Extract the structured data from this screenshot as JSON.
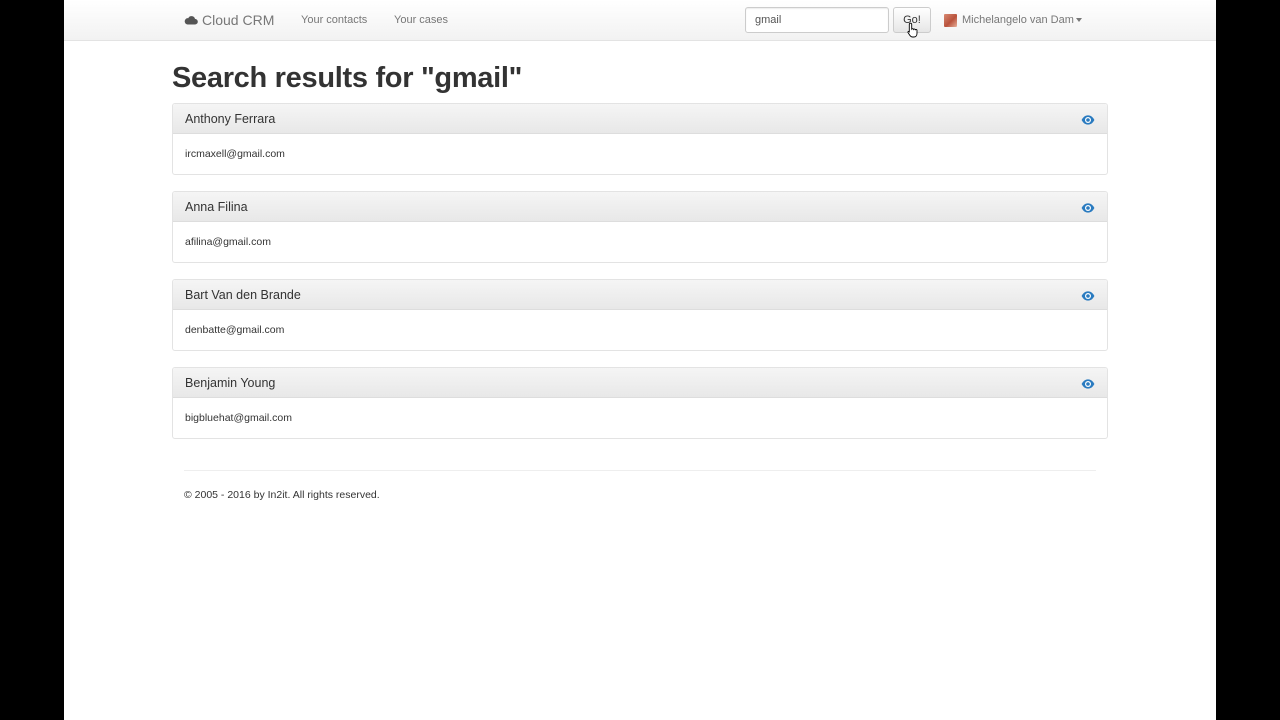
{
  "navbar": {
    "brand": "Cloud CRM",
    "links": [
      {
        "label": "Your contacts"
      },
      {
        "label": "Your cases"
      }
    ],
    "search": {
      "value": "gmail"
    },
    "search_button": "Go!",
    "user": {
      "name": "Michelangelo van Dam"
    }
  },
  "page": {
    "title": "Search results for \"gmail\""
  },
  "results": [
    {
      "name": "Anthony Ferrara",
      "email": "ircmaxell@gmail.com"
    },
    {
      "name": "Anna Filina",
      "email": "afilina@gmail.com"
    },
    {
      "name": "Bart Van den Brande",
      "email": "denbatte@gmail.com"
    },
    {
      "name": "Benjamin Young",
      "email": "bigbluehat@gmail.com"
    }
  ],
  "footer": {
    "copyright": "© 2005 - 2016 by In2it. All rights reserved."
  },
  "icons": {
    "brand": "cloud-icon",
    "view": "eye-icon",
    "user": "avatar",
    "menu": "caret-down-icon"
  },
  "colors": {
    "link_icon": "#2a7bc0",
    "nav_text": "#777777",
    "text": "#333333"
  }
}
